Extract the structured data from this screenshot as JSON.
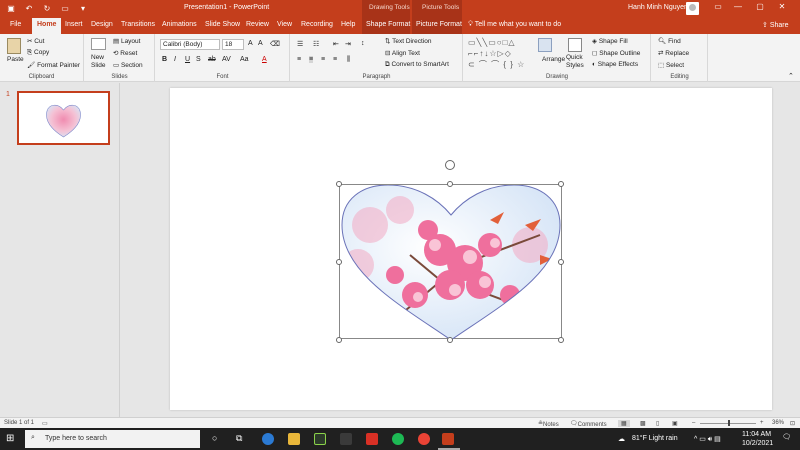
{
  "titlebar": {
    "doc_title": "Presentation1 - PowerPoint",
    "drawing_tools": "Drawing Tools",
    "picture_tools": "Picture Tools",
    "user_name": "Hanh Minh Nguyen"
  },
  "tabs": [
    "File",
    "Home",
    "Insert",
    "Design",
    "Transitions",
    "Animations",
    "Slide Show",
    "Review",
    "View",
    "Recording",
    "Help",
    "Shape Format",
    "Picture Format"
  ],
  "tell_me": "Tell me what you want to do",
  "share": "Share",
  "ribbon": {
    "clipboard": {
      "label": "Clipboard",
      "paste": "Paste",
      "cut": "Cut",
      "copy": "Copy",
      "format_painter": "Format Painter"
    },
    "slides": {
      "label": "Slides",
      "new_slide": "New Slide",
      "layout": "Layout",
      "reset": "Reset",
      "section": "Section"
    },
    "font": {
      "label": "Font",
      "family": "Calibri (Body)",
      "size": "18"
    },
    "paragraph": {
      "label": "Paragraph",
      "text_direction": "Text Direction",
      "align_text": "Align Text",
      "convert_smartart": "Convert to SmartArt"
    },
    "drawing": {
      "label": "Drawing",
      "arrange": "Arrange",
      "quick_styles": "Quick Styles",
      "shape_fill": "Shape Fill",
      "shape_outline": "Shape Outline",
      "shape_effects": "Shape Effects"
    },
    "editing": {
      "label": "Editing",
      "find": "Find",
      "replace": "Replace",
      "select": "Select"
    }
  },
  "thumbnails": {
    "slide_number": "1"
  },
  "status": {
    "slide_info": "Slide 1 of 1",
    "notes": "Notes",
    "comments": "Comments",
    "zoom": "36%"
  },
  "taskbar": {
    "search_placeholder": "Type here to search",
    "weather": "81°F  Light rain",
    "time": "11:04 AM",
    "date": "10/2/2021"
  },
  "colors": {
    "accent": "#c43e1c",
    "ribbon_bg": "#f3f3f3",
    "taskbar_bg": "#202020"
  }
}
